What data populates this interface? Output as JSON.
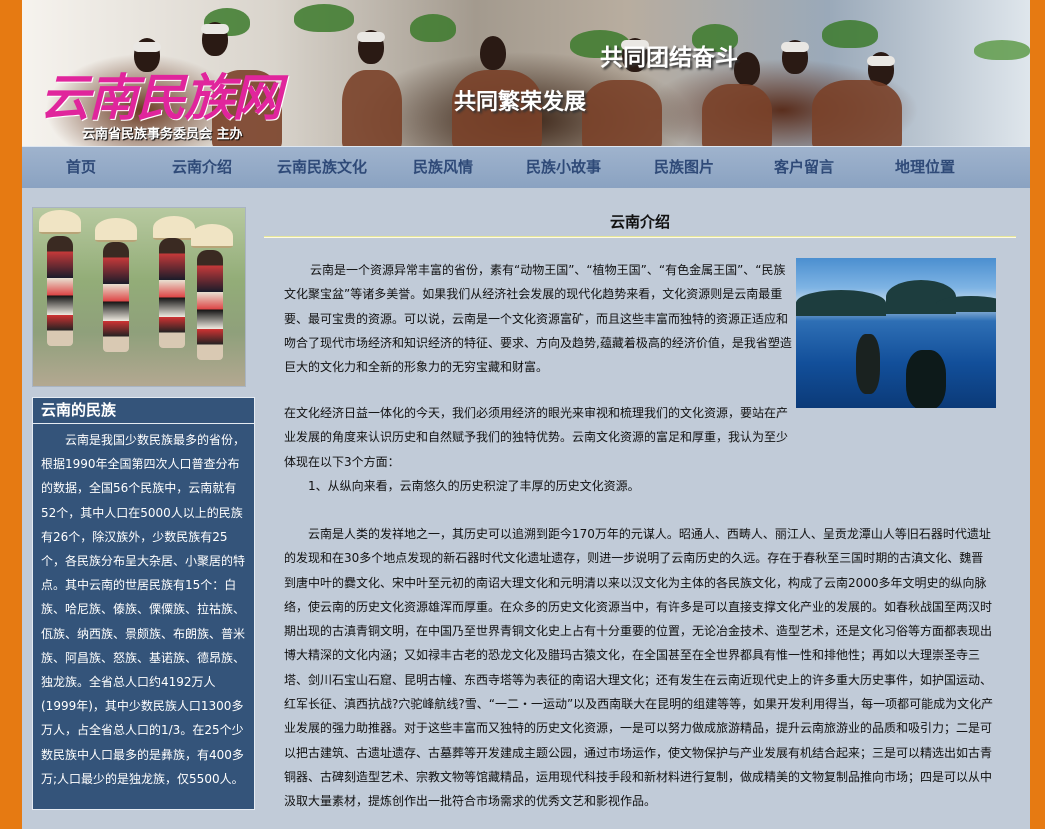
{
  "banner": {
    "logo": "云南民族网",
    "sponsor": "云南省民族事务委员会 主办",
    "slogan_1": "共同团结奋斗",
    "slogan_2": "共同繁荣发展"
  },
  "nav": {
    "items": [
      {
        "label": "首页"
      },
      {
        "label": "云南介绍"
      },
      {
        "label": "云南民族文化"
      },
      {
        "label": "民族风情"
      },
      {
        "label": "民族小故事"
      },
      {
        "label": "民族图片"
      },
      {
        "label": "客户留言"
      },
      {
        "label": "地理位置"
      }
    ]
  },
  "sidebar": {
    "title": "云南的民族",
    "text": "云南是我国少数民族最多的省份，根据1990年全国第四次人口普查分布的数据，全国56个民族中，云南就有52个，其中人口在5000人以上的民族有26个，除汉族外，少数民族有25个，各民族分布呈大杂居、小聚居的特点。其中云南的世居民族有15个：白族、哈尼族、傣族、傈僳族、拉祜族、佤族、纳西族、景颇族、布朗族、普米族、阿昌族、怒族、基诺族、德昂族、独龙族。全省总人口约4192万人(1999年)，其中少数民族人口1300多万人，占全省总人口的1/3。在25个少数民族中人口最多的是彝族，有400多万;人口最少的是独龙族，仅5500人。"
  },
  "main": {
    "title": "云南介绍",
    "p1": "云南是一个资源异常丰富的省份，素有“动物王国”、“植物王国”、“有色金属王国”、“民族文化聚宝盆”等诸多美誉。如果我们从经济社会发展的现代化趋势来看，文化资源则是云南最重要、最可宝贵的资源。可以说，云南是一个文化资源富矿，而且这些丰富而独特的资源正适应和吻合了现代市场经济和知识经济的特征、要求、方向及趋势,蕴藏着极高的经济价值，是我省塑造巨大的文化力和全新的形象力的无穷宝藏和财富。",
    "p2": "在文化经济日益一体化的今天，我们必须用经济的眼光来审视和梳理我们的文化资源，要站在产业发展的角度来认识历史和自然赋予我们的独特优势。云南文化资源的富足和厚重，我认为至少体现在以下3个方面：",
    "p3": "1、从纵向来看，云南悠久的历史积淀了丰厚的历史文化资源。",
    "p4": "云南是人类的发祥地之一，其历史可以追溯到距今170万年的元谋人。昭通人、西畴人、丽江人、呈贡龙潭山人等旧石器时代遗址的发现和在30多个地点发现的新石器时代文化遗址遗存，则进一步说明了云南历史的久远。存在于春秋至三国时期的古滇文化、魏晋到唐中叶的爨文化、宋中叶至元初的南诏大理文化和元明清以来以汉文化为主体的各民族文化，构成了云南2000多年文明史的纵向脉络，使云南的历史文化资源雄浑而厚重。在众多的历史文化资源当中，有许多是可以直接支撑文化产业的发展的。如春秋战国至两汉时期出现的古滇青铜文明，在中国乃至世界青铜文化史上占有十分重要的位置，无论冶金技术、造型艺术，还是文化习俗等方面都表现出博大精深的文化内涵；又如禄丰古老的恐龙文化及腊玛古猿文化，在全国甚至在全世界都具有惟一性和排他性；再如以大理崇圣寺三塔、剑川石宝山石窟、昆明古幢、东西寺塔等为表征的南诏大理文化；还有发生在云南近现代史上的许多重大历史事件，如护国运动、红军长征、滇西抗战?穴驼峰航线?雪、“一二・一运动”以及西南联大在昆明的组建等等，如果开发利用得当，每一项都可能成为文化产业发展的强力助推器。对于这些丰富而又独特的历史文化资源，一是可以努力做成旅游精品，提升云南旅游业的品质和吸引力；二是可以把古建筑、古遗址遗存、古墓葬等开发建成主题公园，通过市场运作，使文物保护与产业发展有机结合起来；三是可以精选出如古青铜器、古碑刻造型艺术、宗教文物等馆藏精品，运用现代科技手段和新材料进行复制，做成精美的文物复制品推向市场；四是可以从中汲取大量素材，提炼创作出一批符合市场需求的优秀文艺和影视作品。"
  },
  "colors": {
    "outer_frame": "#e67a12",
    "page_bg": "#c1cbd8",
    "nav_bg": "#8aa2c1",
    "nav_text": "#2f4a78",
    "sidebar_box": "#34547a",
    "logo": "#e0259c"
  }
}
